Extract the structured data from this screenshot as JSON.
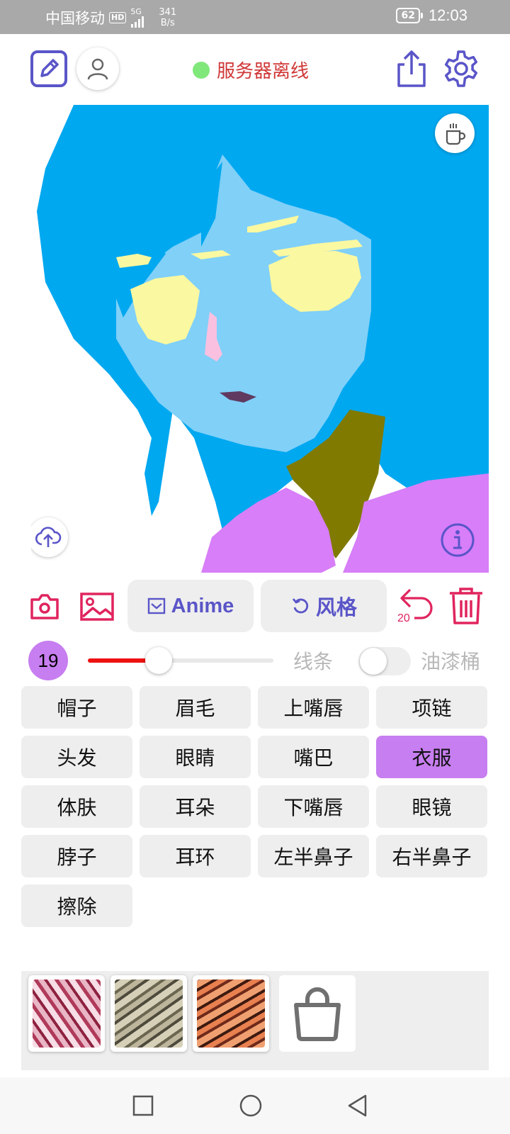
{
  "status_bar": {
    "carrier": "中国移动",
    "hd": "HD",
    "network": "5G",
    "speed_value": "341",
    "speed_unit": "B/s",
    "battery": "62",
    "time": "12:03"
  },
  "header": {
    "server_status": "服务器离线",
    "status_color": "#80e87a"
  },
  "toolbar": {
    "model_button": "Anime",
    "style_button": "风格",
    "undo_count": "20"
  },
  "brush": {
    "size": "19",
    "size_fraction": 0.38,
    "line_label": "线条",
    "bucket_label": "油漆桶",
    "bucket_enabled": false,
    "brush_color": "#ee1111"
  },
  "parts": [
    {
      "label": "帽子",
      "active": false
    },
    {
      "label": "眉毛",
      "active": false
    },
    {
      "label": "上嘴唇",
      "active": false
    },
    {
      "label": "项链",
      "active": false
    },
    {
      "label": "头发",
      "active": false
    },
    {
      "label": "眼睛",
      "active": false
    },
    {
      "label": "嘴巴",
      "active": false
    },
    {
      "label": "衣服",
      "active": true
    },
    {
      "label": "体肤",
      "active": false
    },
    {
      "label": "耳朵",
      "active": false
    },
    {
      "label": "下嘴唇",
      "active": false
    },
    {
      "label": "眼镜",
      "active": false
    },
    {
      "label": "脖子",
      "active": false
    },
    {
      "label": "耳环",
      "active": false
    },
    {
      "label": "左半鼻子",
      "active": false
    },
    {
      "label": "右半鼻子",
      "active": false
    },
    {
      "label": "擦除",
      "active": false
    }
  ],
  "colors": {
    "accent": "#5a55c8",
    "danger": "#e0245e",
    "selected_part": "#c77ef0",
    "hair": "#00a8f0",
    "skin": "#80d0f8",
    "eyes": "#faf8a0",
    "clothes": "#d77ef8",
    "neck": "#807a00"
  },
  "icons": {
    "draw": "edit-square-icon",
    "account": "person-icon",
    "share": "share-icon",
    "settings": "gear-icon",
    "coffee": "coffee-cup-icon",
    "upload": "cloud-upload-icon",
    "info": "info-icon",
    "camera": "camera-icon",
    "gallery": "image-icon",
    "undo": "undo-icon",
    "delete": "trash-icon",
    "shop": "shopping-bag-icon"
  }
}
